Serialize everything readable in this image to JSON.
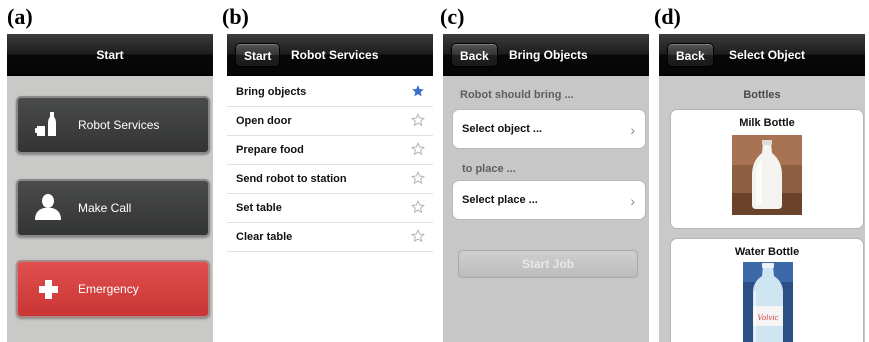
{
  "panel_labels": [
    "(a)",
    "(b)",
    "(c)",
    "(d)"
  ],
  "panel_a": {
    "title": "Start",
    "buttons": [
      {
        "label": "Robot Services",
        "icon": "bottles-icon"
      },
      {
        "label": "Make Call",
        "icon": "person-icon"
      },
      {
        "label": "Emergency",
        "icon": "plus-cross-icon"
      }
    ],
    "colors": {
      "dark_button": "#3a3b3b",
      "emergency": "#d54241",
      "background": "#c9c9c7"
    }
  },
  "panel_b": {
    "back_button": "Start",
    "title": "Robot Services",
    "items": [
      {
        "label": "Bring objects",
        "favorite": true
      },
      {
        "label": "Open door",
        "favorite": false
      },
      {
        "label": "Prepare food",
        "favorite": false
      },
      {
        "label": "Send robot to station",
        "favorite": false
      },
      {
        "label": "Set table",
        "favorite": false
      },
      {
        "label": "Clear table",
        "favorite": false
      }
    ],
    "colors": {
      "star_active": "#3a6fc9",
      "star_inactive": "#b0b0b0"
    }
  },
  "panel_c": {
    "back_button": "Back",
    "title": "Bring Objects",
    "caption_1": "Robot should bring ...",
    "select_object": "Select object ...",
    "caption_2": "to place ...",
    "select_place": "Select place ...",
    "start_button": "Start Job",
    "chevron": "›"
  },
  "panel_d": {
    "back_button": "Back",
    "title": "Select Object",
    "caption": "Bottles",
    "objects": [
      {
        "name": "Milk Bottle",
        "image": "milk-bottle-photo"
      },
      {
        "name": "Water Bottle",
        "image": "water-bottle-photo"
      }
    ],
    "water_bottle_brand": "Volvic"
  }
}
